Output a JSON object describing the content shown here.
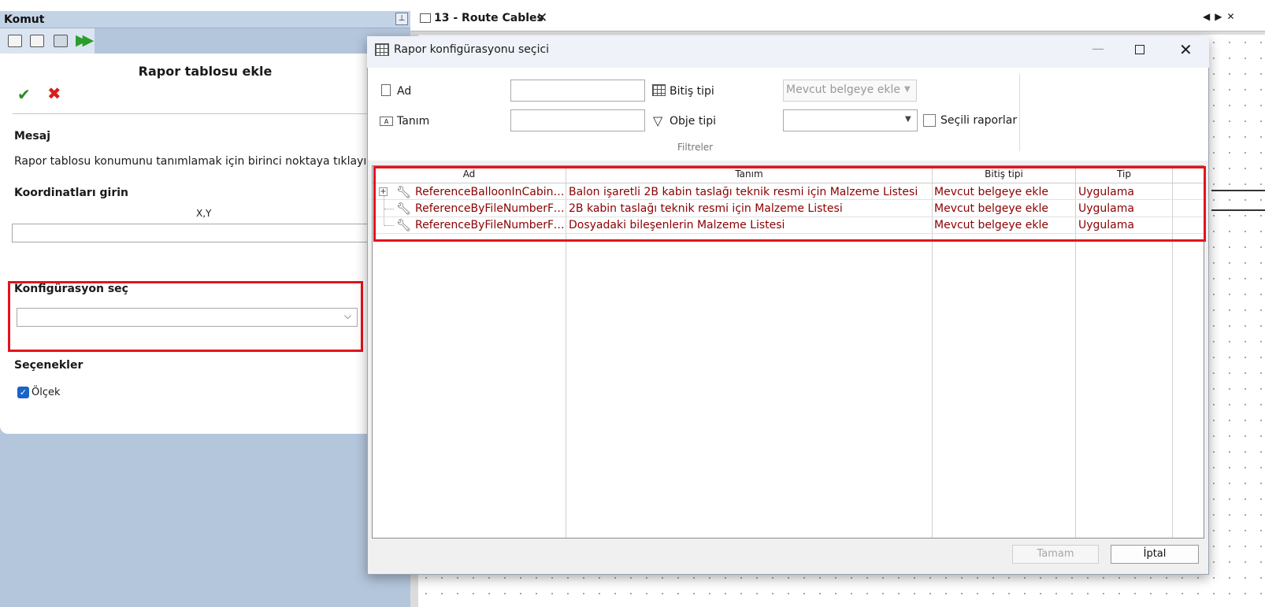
{
  "command_panel": {
    "title": "Komut",
    "pin_glyph": "⊥",
    "panel_title": "Rapor tablosu ekle",
    "message_label": "Mesaj",
    "message_text": "Rapor tablosu konumunu tanımlamak için birinci noktaya tıklayın.",
    "coords_label": "Koordinatları girin",
    "coords_column": "X,Y",
    "coords_value": "",
    "config_label": "Konfigürasyon seç",
    "config_value": "",
    "options_label": "Seçenekler",
    "scale_label": "Ölçek",
    "scale_checked": true
  },
  "document_tab": {
    "label": "13 - Route Cables"
  },
  "dialog": {
    "title": "Rapor konfigürasyonu seçici",
    "filters": {
      "name_label": "Ad",
      "name_value": "",
      "desc_label": "Tanım",
      "desc_value": "",
      "end_type_label": "Bitiş tipi",
      "end_type_value": "Mevcut belgeye ekle",
      "object_type_label": "Obje tipi",
      "object_type_value": "",
      "selected_reports_label": "Seçili raporlar",
      "selected_reports_checked": false,
      "caption": "Filtreler"
    },
    "grid": {
      "columns": [
        "Ad",
        "Tanım",
        "Bitiş tipi",
        "Tip"
      ],
      "rows": [
        {
          "name": "ReferenceBalloonInCabinet_...",
          "desc": "Balon işaretli 2B kabin taslağı teknik resmi için Malzeme Listesi",
          "end_type": "Mevcut belgeye ekle",
          "type": "Uygulama"
        },
        {
          "name": "ReferenceByFileNumberFor...",
          "desc": "2B kabin taslağı teknik resmi için Malzeme Listesi",
          "end_type": "Mevcut belgeye ekle",
          "type": "Uygulama"
        },
        {
          "name": "ReferenceByFileNumberFor...",
          "desc": "Dosyadaki bileşenlerin Malzeme Listesi",
          "end_type": "Mevcut belgeye ekle",
          "type": "Uygulama"
        }
      ]
    },
    "buttons": {
      "ok": "Tamam",
      "cancel": "İptal"
    }
  },
  "colors": {
    "highlight": "#e3131e",
    "row_text": "#8b0000",
    "panel_header": "#c3d3e6",
    "panel_bg": "#b4c6dc"
  }
}
